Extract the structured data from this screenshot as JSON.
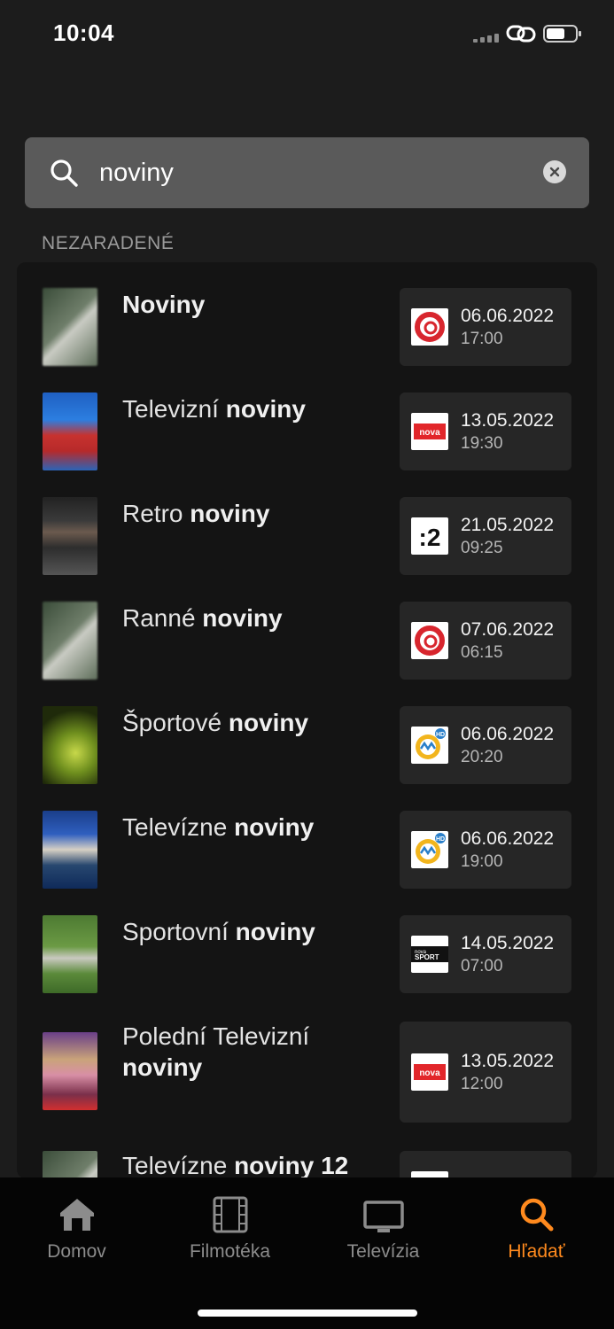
{
  "status_bar": {
    "time": "10:04"
  },
  "search": {
    "value": "noviny",
    "placeholder": ""
  },
  "section": {
    "label": "NEZARADENÉ"
  },
  "results": [
    {
      "title_plain": "",
      "title_bold": "Noviny",
      "channel_icon": "joj-logo",
      "date": "06.06.2022",
      "time": "17:00",
      "thumb": "blurred-placeholder"
    },
    {
      "title_plain": "Televizní ",
      "title_bold": "noviny",
      "channel_icon": "nova-international-logo",
      "date": "13.05.2022",
      "time": "19:30",
      "thumb": "news-anchor-red-dress"
    },
    {
      "title_plain": "Retro ",
      "title_bold": "noviny",
      "channel_icon": "dvojka-logo",
      "date": "21.05.2022",
      "time": "09:25",
      "thumb": "news-anchor-suit"
    },
    {
      "title_plain": "Ranné ",
      "title_bold": "noviny",
      "channel_icon": "joj-logo",
      "date": "07.06.2022",
      "time": "06:15",
      "thumb": "blurred-placeholder"
    },
    {
      "title_plain": "Športové ",
      "title_bold": "noviny",
      "channel_icon": "markiza-hd-logo",
      "date": "06.06.2022",
      "time": "20:20",
      "thumb": "sport-news-graphic"
    },
    {
      "title_plain": "Televízne ",
      "title_bold": "noviny",
      "channel_icon": "markiza-hd-logo",
      "date": "06.06.2022",
      "time": "19:00",
      "thumb": "news-studio"
    },
    {
      "title_plain": "Sportovní ",
      "title_bold": "noviny",
      "channel_icon": "nova-sport-logo",
      "date": "14.05.2022",
      "time": "07:00",
      "thumb": "football-pitch"
    },
    {
      "title_plain": "Polední Televizní ",
      "title_bold": "noviny",
      "channel_icon": "nova-international-logo",
      "date": "13.05.2022",
      "time": "12:00",
      "thumb": "news-studio-presenter"
    },
    {
      "title_plain": "Televízne ",
      "title_bold": "noviny 12",
      "channel_icon": "channel-logo",
      "date": "",
      "time": "",
      "thumb": "blurred-placeholder"
    }
  ],
  "tabbar": {
    "items": [
      {
        "label": "Domov",
        "icon": "home-icon",
        "active": false
      },
      {
        "label": "Filmotéka",
        "icon": "film-icon",
        "active": false
      },
      {
        "label": "Televízia",
        "icon": "tv-icon",
        "active": false
      },
      {
        "label": "Hľadať",
        "icon": "search-icon",
        "active": true
      }
    ]
  },
  "colors": {
    "accent": "#ff8a1e",
    "background": "#1c1c1c",
    "card": "#262626",
    "list": "#141414"
  }
}
